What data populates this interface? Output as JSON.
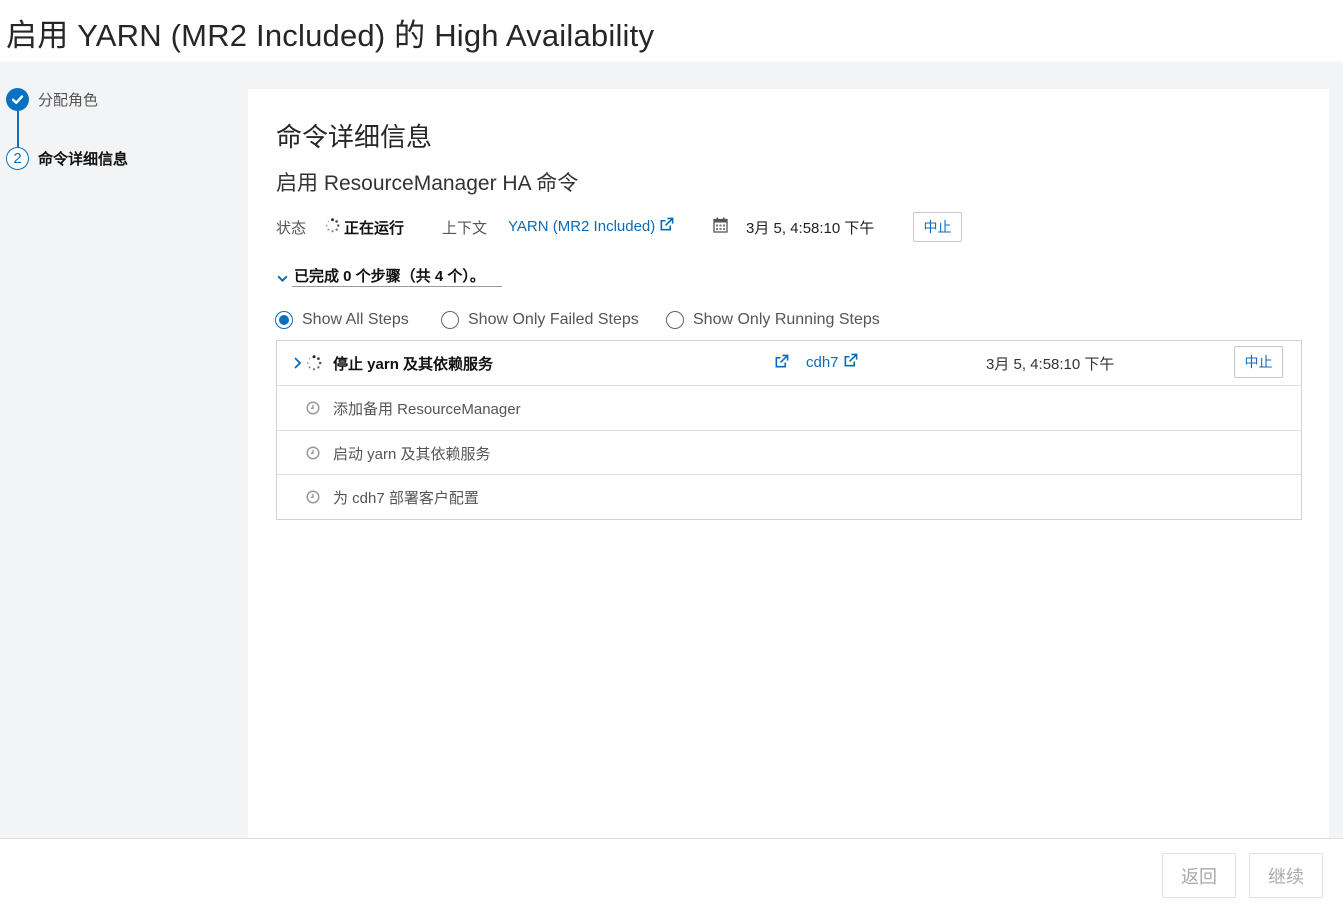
{
  "page": {
    "title": "启用 YARN (MR2 Included) 的 High Availability"
  },
  "wizard": {
    "steps": [
      {
        "label": "分配角色",
        "state": "completed"
      },
      {
        "number": "2",
        "label": "命令详细信息",
        "state": "current"
      }
    ]
  },
  "command": {
    "heading": "命令详细信息",
    "name": "启用 ResourceManager HA 命令",
    "status_label": "状态",
    "status_value": "正在运行",
    "context_label": "上下文",
    "context_value": "YARN (MR2 Included)",
    "start_time": "3月 5, 4:58:10 下午",
    "abort_label": "中止"
  },
  "steps_summary": "已完成 0 个步骤（共 4 个）。",
  "filters": {
    "options": [
      "Show All Steps",
      "Show Only Failed Steps",
      "Show Only Running Steps"
    ],
    "selected": "Show All Steps"
  },
  "steps": {
    "running": {
      "name": "停止 yarn 及其依赖服务",
      "host": "cdh7",
      "time": "3月 5, 4:58:10 下午",
      "abort_label": "中止"
    },
    "pending": [
      "添加备用 ResourceManager",
      "启动 yarn 及其依赖服务",
      "为 cdh7 部署客户配置"
    ]
  },
  "footer": {
    "back_label": "返回",
    "continue_label": "继续"
  },
  "colors": {
    "accent": "#0a70c0",
    "link": "#0a6bbd",
    "background": "#f3f4f5"
  },
  "icons": [
    "check-icon",
    "spinner-icon",
    "external-link-icon",
    "calendar-icon",
    "chevron-down-icon",
    "chevron-right-icon",
    "clock-icon"
  ]
}
